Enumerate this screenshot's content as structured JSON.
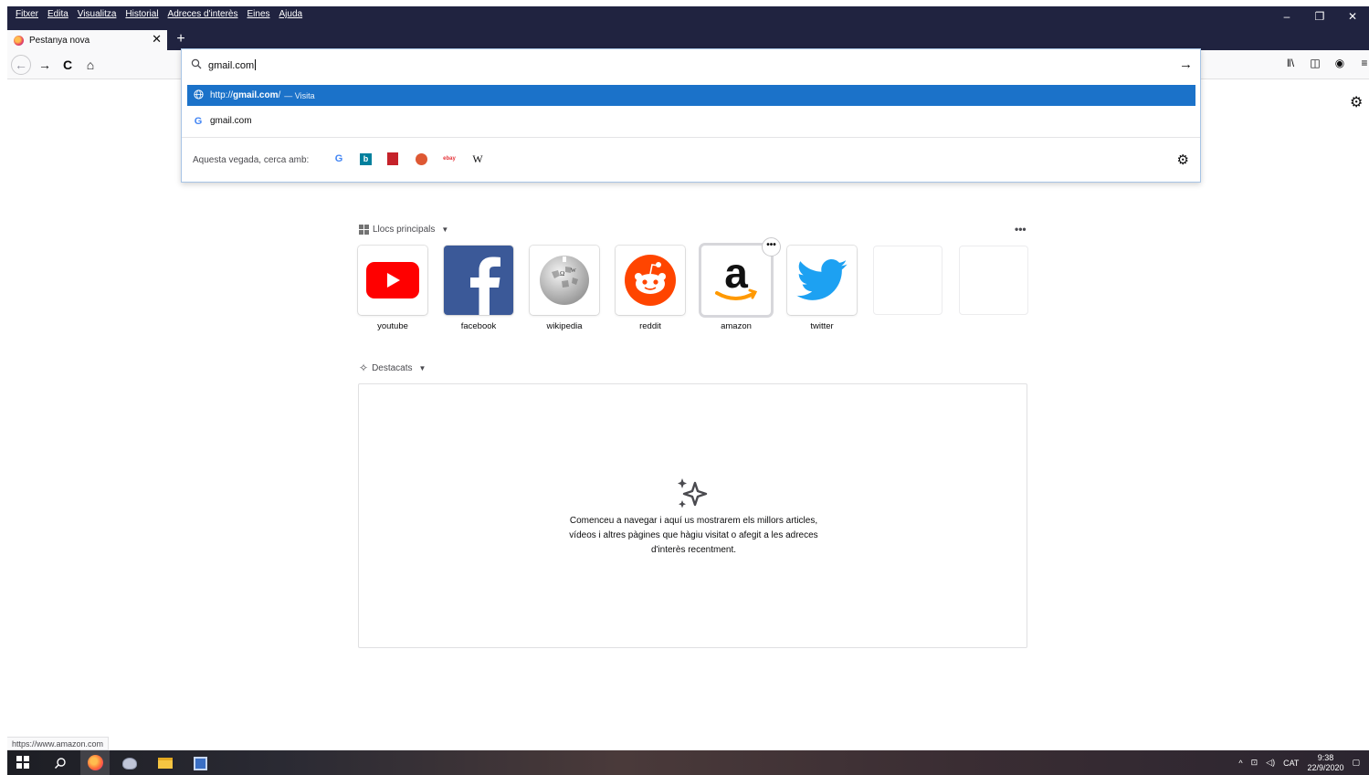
{
  "menubar": {
    "items": [
      "Fitxer",
      "Edita",
      "Visualitza",
      "Historial",
      "Adreces d'interès",
      "Eines",
      "Ajuda"
    ]
  },
  "window_controls": {
    "minimize": "–",
    "restore": "❐",
    "close": "✕"
  },
  "tab": {
    "title": "Pestanya nova",
    "close": "✕"
  },
  "newtab_button": "+",
  "navbar": {
    "back": "←",
    "forward": "→",
    "reload": "C",
    "home": "⌂"
  },
  "urlbar": {
    "value": "gmail.com",
    "go": "→",
    "results": [
      {
        "url_prefix": "http://",
        "url_bold": "gmail.com",
        "url_suffix": "/",
        "action": "— Visita",
        "icon": "globe-icon",
        "selected": true
      },
      {
        "text": "gmail.com",
        "icon": "google-icon",
        "selected": false
      }
    ],
    "oneoff_label": "Aquesta vegada, cerca amb:",
    "engines": [
      {
        "name": "google",
        "glyph": "G"
      },
      {
        "name": "bing",
        "glyph": "b"
      },
      {
        "name": "book",
        "glyph": ""
      },
      {
        "name": "duckduckgo",
        "glyph": ""
      },
      {
        "name": "ebay",
        "glyph": "ebay"
      },
      {
        "name": "wikipedia",
        "glyph": "W"
      }
    ],
    "settings_icon": "⚙"
  },
  "toolbar_right": {
    "library": "ǁ\\",
    "sidebar": "◫",
    "account": "◉",
    "menu": "≡"
  },
  "page_settings": "⚙",
  "top_sites": {
    "header": "Llocs principals",
    "more": "•••",
    "tiles": [
      {
        "label": "youtube",
        "icon": "youtube-icon"
      },
      {
        "label": "facebook",
        "icon": "facebook-icon"
      },
      {
        "label": "wikipedia",
        "icon": "wikipedia-icon"
      },
      {
        "label": "reddit",
        "icon": "reddit-icon"
      },
      {
        "label": "amazon",
        "icon": "amazon-icon"
      },
      {
        "label": "twitter",
        "icon": "twitter-icon"
      },
      {
        "label": "",
        "icon": ""
      },
      {
        "label": "",
        "icon": ""
      }
    ],
    "tile_menu": "•••"
  },
  "highlights": {
    "header": "Destacats",
    "message": "Comenceu a navegar i aquí us mostrarem els millors articles, vídeos i altres pàgines que hàgiu visitat o afegit a les adreces d'interès recentment."
  },
  "status_url": "https://www.amazon.com",
  "taskbar": {
    "tray_chevron": "^",
    "language": "CAT",
    "time": "9:38",
    "date": "22/9/2020"
  },
  "colors": {
    "titlebar": "#202340",
    "selected_result": "#1b72c9",
    "youtube": "#ff0000",
    "facebook": "#3b5998",
    "reddit": "#ff4500",
    "twitter": "#1da1f2",
    "amazon_smile": "#ff9900"
  }
}
